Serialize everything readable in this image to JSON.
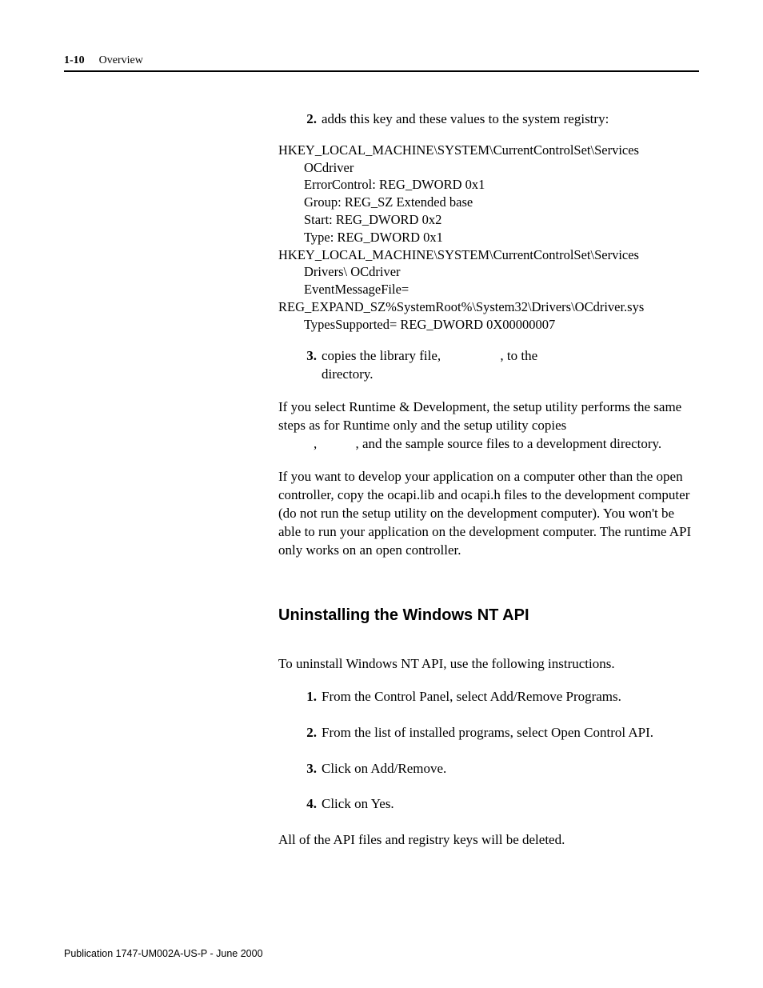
{
  "header": {
    "page_num": "1-10",
    "section": "Overview"
  },
  "body": {
    "item2_num": "2.",
    "item2_text": "adds this key and these values to the system registry:",
    "reg": {
      "l1": "HKEY_LOCAL_MACHINE\\SYSTEM\\CurrentControlSet\\Services",
      "l2": "OCdriver",
      "l3": "ErrorControl: REG_DWORD 0x1",
      "l4": "Group: REG_SZ Extended base",
      "l5": "Start: REG_DWORD 0x2",
      "l6": "Type: REG_DWORD 0x1",
      "l7": "HKEY_LOCAL_MACHINE\\SYSTEM\\CurrentControlSet\\Services",
      "l8": "Drivers\\ OCdriver",
      "l9": "EventMessageFile=",
      "l10": "REG_EXPAND_SZ%SystemRoot%\\System32\\Drivers\\OCdriver.sys",
      "l11": "TypesSupported= REG_DWORD 0X00000007"
    },
    "item3_num": "3.",
    "item3_a": "copies the library file, ",
    "item3_b": ", to the ",
    "item3_c": "directory.",
    "para1_a": "If you select Runtime & Development, the setup utility performs the same steps as for Runtime only and the setup utility copies ",
    "para1_gap_comma": ", ",
    "para1_b": ", and the sample source files to a development directory.",
    "para2": "If you want to develop your application on a computer other than the open controller, copy the ocapi.lib and ocapi.h files to the development computer (do not run the setup utility on the development computer). You won't be able to run your application on the development computer. The runtime API only works on an open controller.",
    "h2": "Uninstalling the Windows NT API",
    "intro": "To uninstall Windows NT API, use the following instructions.",
    "steps": {
      "n1": "1.",
      "t1": "From the Control Panel, select Add/Remove Programs.",
      "n2": "2.",
      "t2": "From the list of installed programs, select Open Control API.",
      "n3": "3.",
      "t3": "Click on Add/Remove.",
      "n4": "4.",
      "t4": "Click on Yes."
    },
    "closing": "All of the API files and registry keys will be deleted."
  },
  "footer": {
    "pub": "Publication 1747-UM002A-US-P - June 2000"
  }
}
